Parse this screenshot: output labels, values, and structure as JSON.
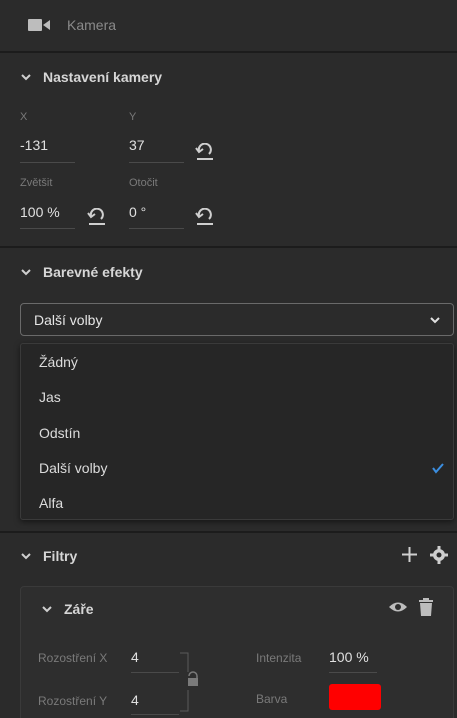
{
  "header": {
    "title": "Kamera",
    "icon": "video-camera-icon"
  },
  "camera_settings": {
    "title": "Nastavení kamery",
    "x_label": "X",
    "x_value": "-131",
    "y_label": "Y",
    "y_value": "37",
    "zoom_label": "Zvětšit",
    "zoom_value": "100 %",
    "rotate_label": "Otočit",
    "rotate_value": "0 °"
  },
  "color_effects": {
    "title": "Barevné efekty",
    "selected": "Další volby",
    "options": [
      "Žádný",
      "Jas",
      "Odstín",
      "Další volby",
      "Alfa"
    ]
  },
  "filters": {
    "title": "Filtry",
    "glow": {
      "title": "Záře",
      "blur_x_label": "Rozostření X",
      "blur_x_value": "4",
      "blur_y_label": "Rozostření Y",
      "blur_y_value": "4",
      "intensity_label": "Intenzita",
      "intensity_value": "100 %",
      "color_label": "Barva",
      "color": "#ff0000"
    }
  },
  "colors": {
    "background": "#2b2b2b",
    "accent_check": "#3b8ee0",
    "swatch": "#ff0000"
  }
}
